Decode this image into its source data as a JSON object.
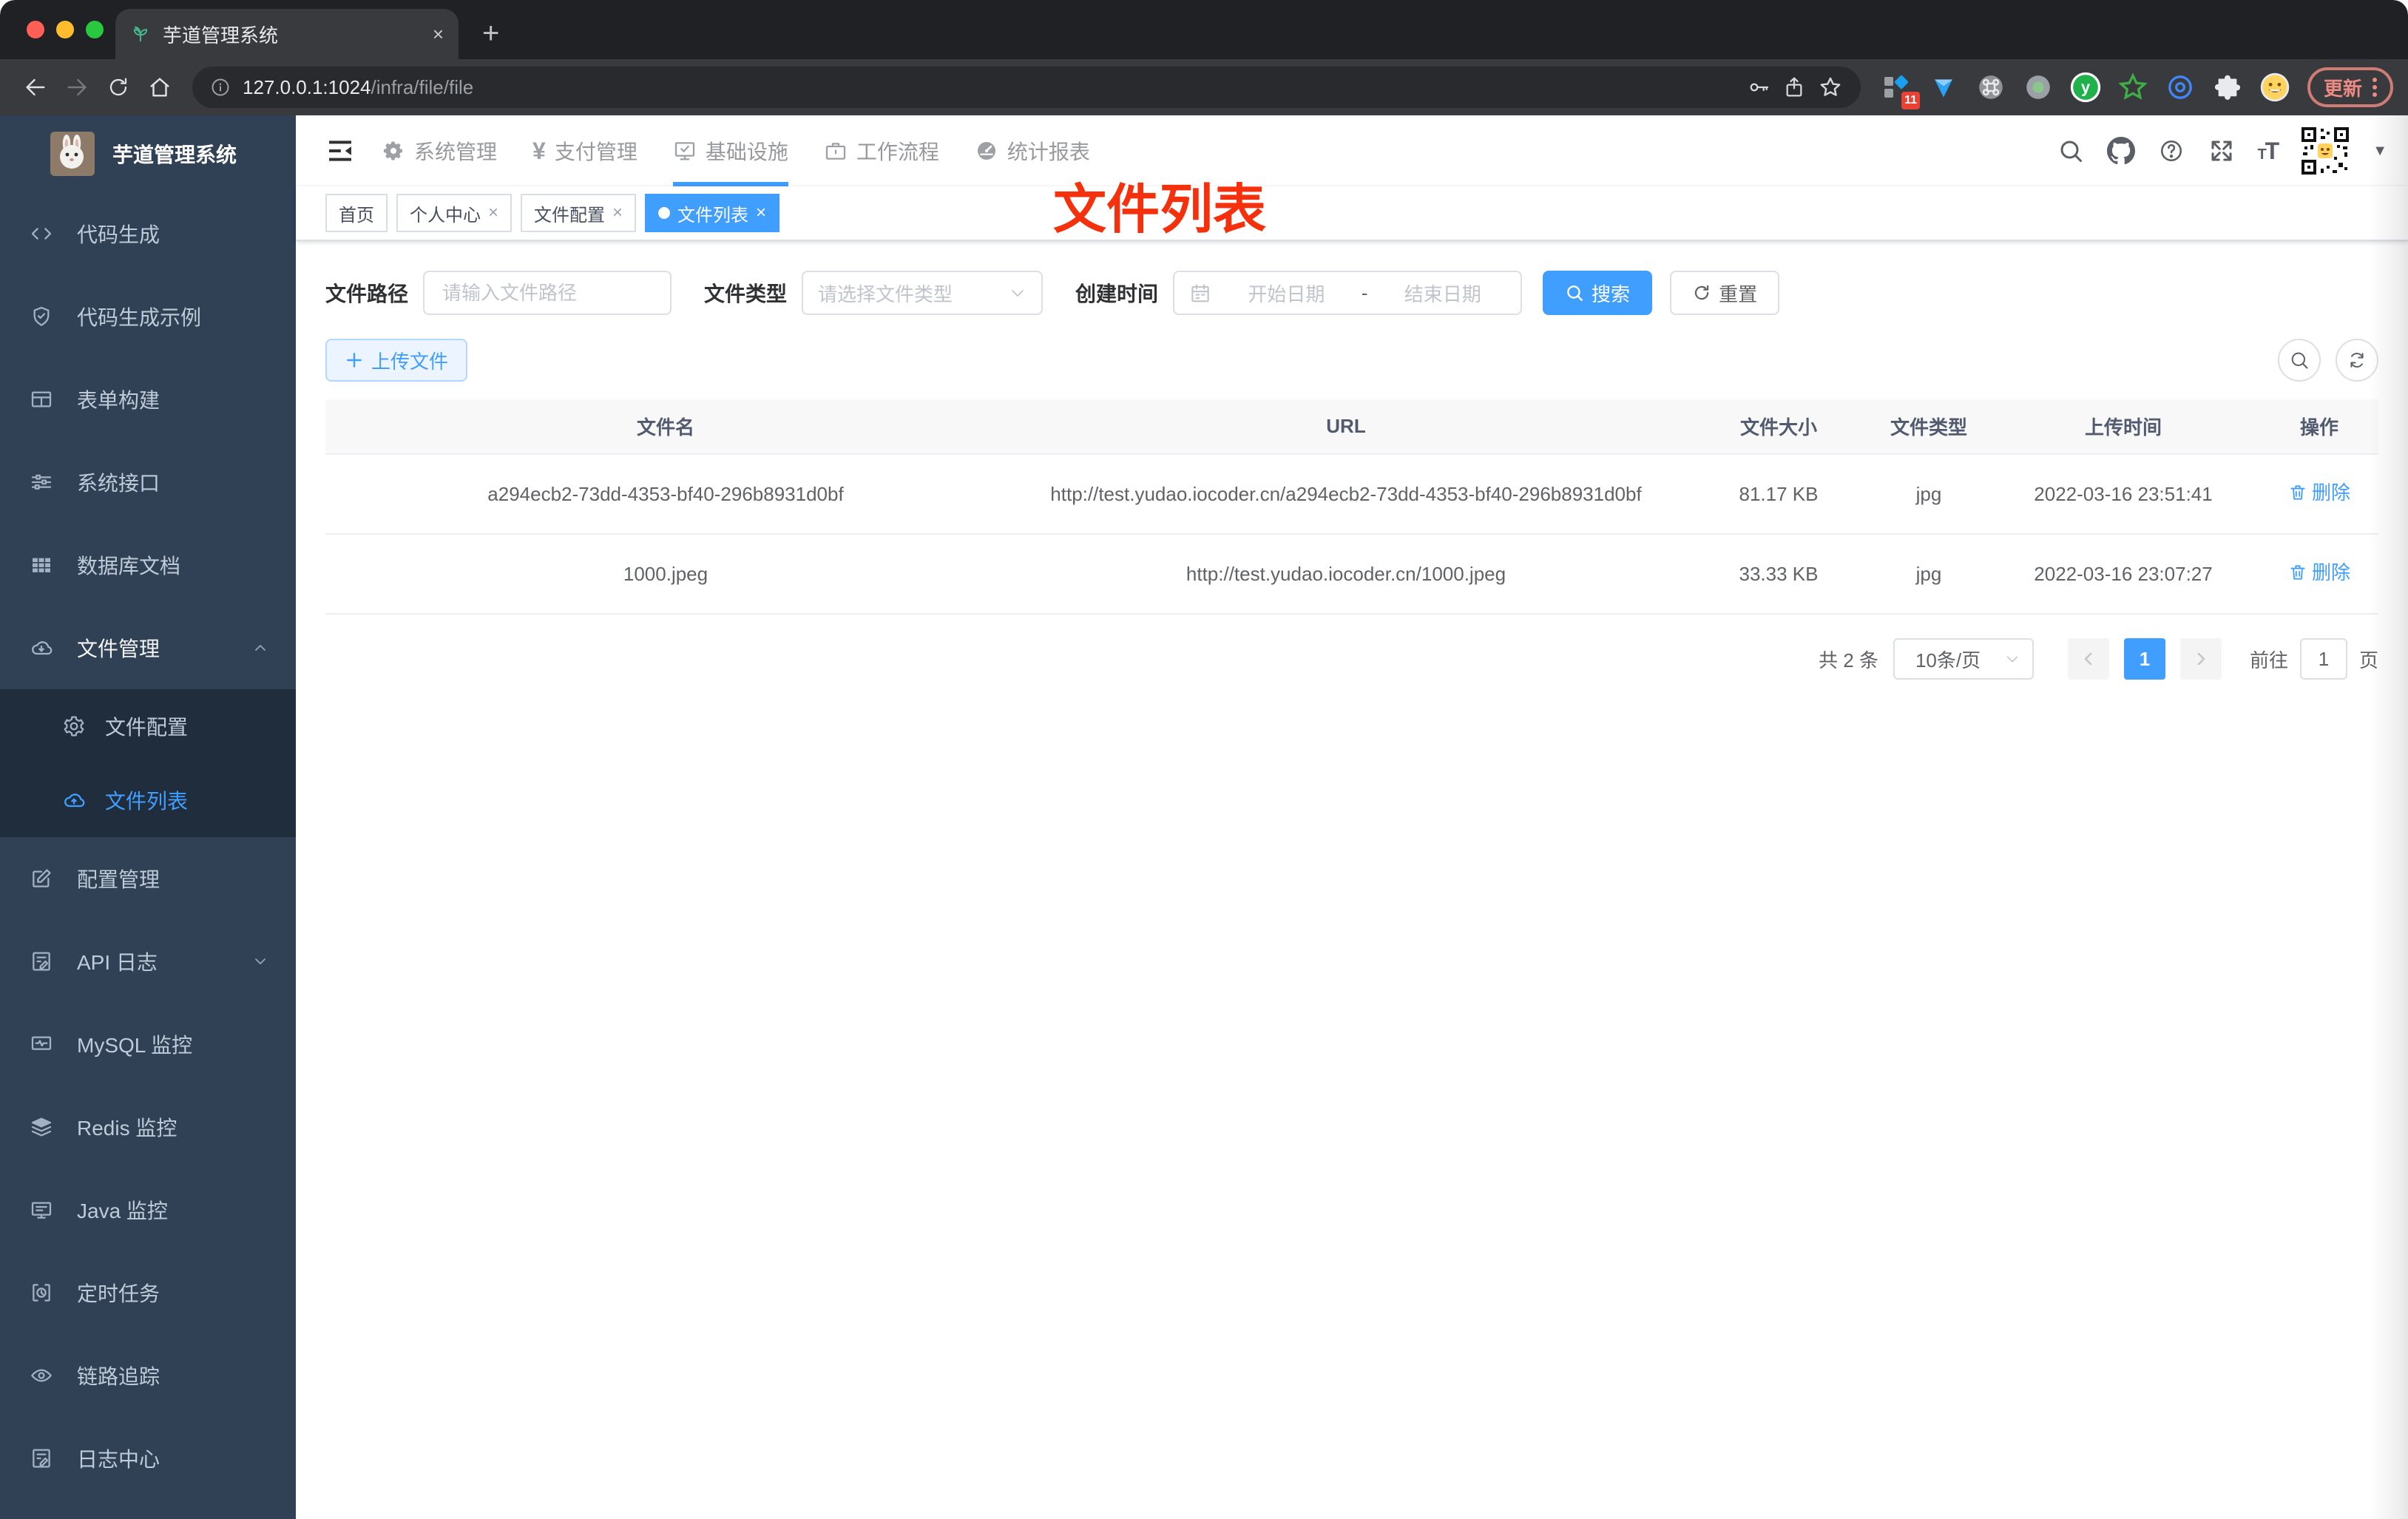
{
  "browser": {
    "tab_title": "芋道管理系统",
    "url_host": "127.0.0.1:1024",
    "url_path": "/infra/file/file",
    "extension_badge": "11",
    "update_button": "更新",
    "new_tab": "+",
    "close_tab": "×"
  },
  "header": {
    "nav": [
      {
        "label": "系统管理"
      },
      {
        "label": "支付管理"
      },
      {
        "label": "基础设施"
      },
      {
        "label": "工作流程"
      },
      {
        "label": "统计报表"
      }
    ]
  },
  "sidebar": {
    "title": "芋道管理系统",
    "items": [
      {
        "label": "代码生成"
      },
      {
        "label": "代码生成示例"
      },
      {
        "label": "表单构建"
      },
      {
        "label": "系统接口"
      },
      {
        "label": "数据库文档"
      },
      {
        "label": "文件管理"
      },
      {
        "label": "文件配置"
      },
      {
        "label": "文件列表"
      },
      {
        "label": "配置管理"
      },
      {
        "label": "API 日志"
      },
      {
        "label": "MySQL 监控"
      },
      {
        "label": "Redis 监控"
      },
      {
        "label": "Java 监控"
      },
      {
        "label": "定时任务"
      },
      {
        "label": "链路追踪"
      },
      {
        "label": "日志中心"
      }
    ]
  },
  "tags": [
    {
      "label": "首页"
    },
    {
      "label": "个人中心",
      "close": "×"
    },
    {
      "label": "文件配置",
      "close": "×"
    },
    {
      "label": "文件列表",
      "close": "×"
    }
  ],
  "annotation": {
    "text": "文件列表"
  },
  "filter": {
    "path_label": "文件路径",
    "path_placeholder": "请输入文件路径",
    "type_label": "文件类型",
    "type_placeholder": "请选择文件类型",
    "time_label": "创建时间",
    "start_placeholder": "开始日期",
    "separator": "-",
    "end_placeholder": "结束日期",
    "search_label": "搜索",
    "reset_label": "重置"
  },
  "toolbar": {
    "upload_label": "上传文件"
  },
  "table": {
    "columns": [
      "文件名",
      "URL",
      "文件大小",
      "文件类型",
      "上传时间",
      "操作"
    ],
    "rows": [
      {
        "name": "a294ecb2-73dd-4353-bf40-296b8931d0bf",
        "url": "http://test.yudao.iocoder.cn/a294ecb2-73dd-4353-bf40-296b8931d0bf",
        "size": "81.17 KB",
        "type": "jpg",
        "time": "2022-03-16 23:51:41",
        "action": "删除"
      },
      {
        "name": "1000.jpeg",
        "url": "http://test.yudao.iocoder.cn/1000.jpeg",
        "size": "33.33 KB",
        "type": "jpg",
        "time": "2022-03-16 23:07:27",
        "action": "删除"
      }
    ]
  },
  "pagination": {
    "total": "共 2 条",
    "page_size": "10条/页",
    "current_page": "1",
    "goto_label": "前往",
    "goto_value": "1",
    "page_unit": "页"
  },
  "colors": {
    "accent": "#409EFF",
    "sidebar_bg": "#304156",
    "submenu_bg": "#1f2d3d",
    "annotation": "#f5300c"
  }
}
